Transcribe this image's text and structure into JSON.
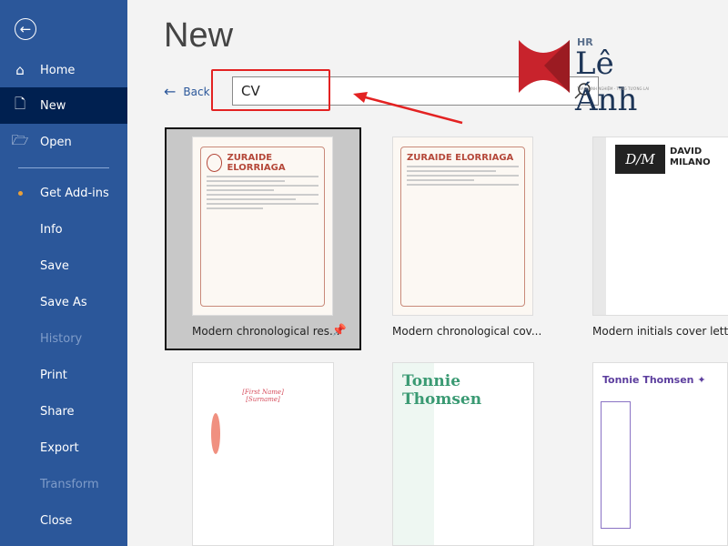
{
  "sidebar": {
    "items": [
      {
        "label": "Home",
        "icon": "home-icon"
      },
      {
        "label": "New",
        "icon": "new-document-icon",
        "selected": true
      },
      {
        "label": "Open",
        "icon": "folder-open-icon"
      },
      {
        "label": "Get Add-ins",
        "icon": "dot-icon"
      },
      {
        "label": "Info"
      },
      {
        "label": "Save"
      },
      {
        "label": "Save As"
      },
      {
        "label": "History",
        "disabled": true
      },
      {
        "label": "Print"
      },
      {
        "label": "Share"
      },
      {
        "label": "Export"
      },
      {
        "label": "Transform",
        "disabled": true
      },
      {
        "label": "Close"
      }
    ]
  },
  "header": {
    "title": "New",
    "back_label": "Back"
  },
  "search": {
    "value": "CV"
  },
  "logo": {
    "hr": "HR",
    "name": "Lê Ánh",
    "tagline": "TRAO KINH NGHIỆM - TẶNG TƯƠNG LAI"
  },
  "templates": [
    {
      "label": "Modern chronological res...",
      "thumb_name": "ZURAIDE ELORRIAGA",
      "selected": true
    },
    {
      "label": "Modern chronological cov...",
      "thumb_name": "ZURAIDE ELORRIAGA"
    },
    {
      "label": "Modern initials cover letter",
      "thumb_initials": "D/M",
      "thumb_name": "DAVID MILANO"
    },
    {
      "thumb_name": "[First Name] [Surname]"
    },
    {
      "thumb_name": "Tonnie Thomsen"
    },
    {
      "thumb_name": "Tonnie Thomsen"
    }
  ],
  "colors": {
    "sidebar": "#2b579a",
    "sidebar_selected": "#002050",
    "annotation": "#e32222"
  }
}
